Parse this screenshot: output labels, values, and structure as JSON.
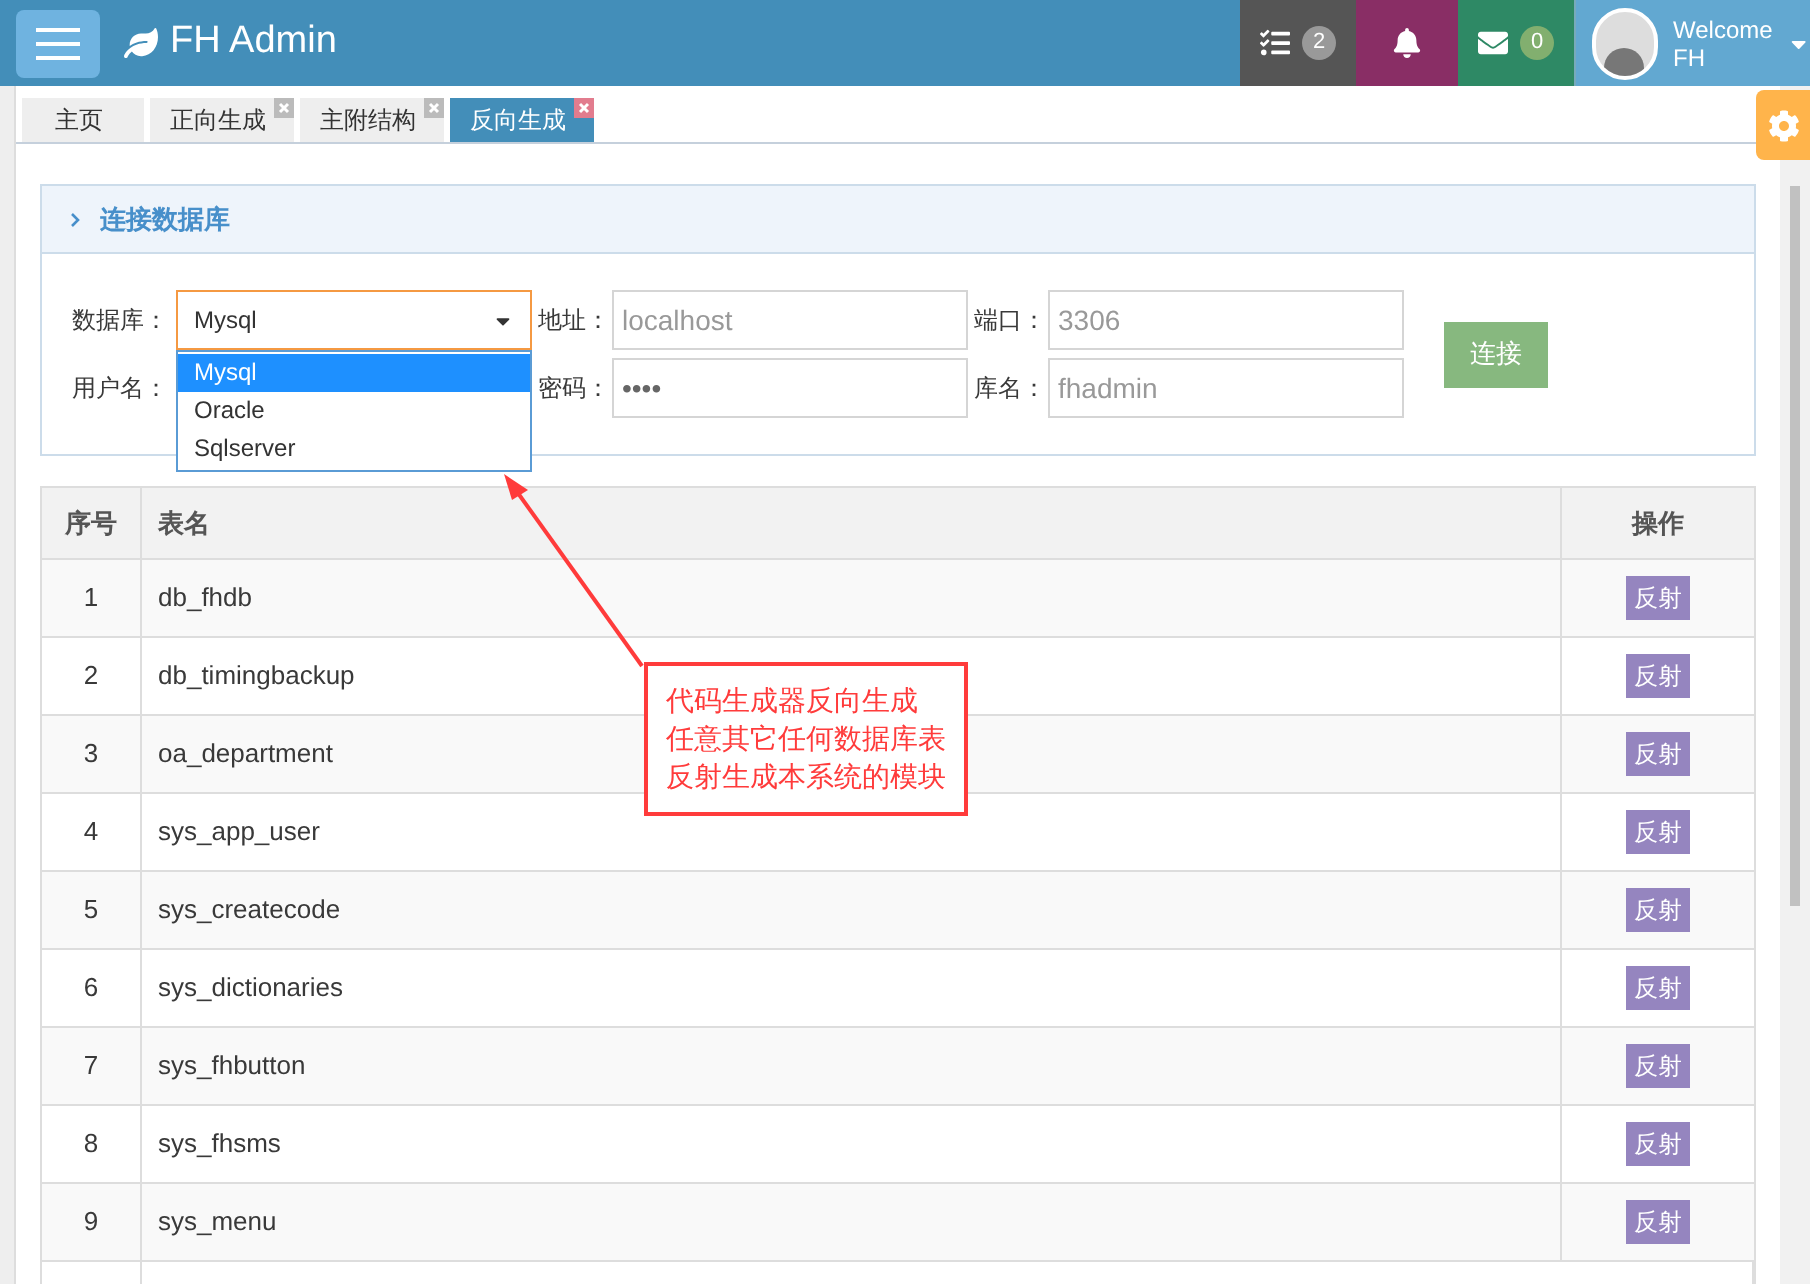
{
  "navbar": {
    "brand": "FH Admin",
    "tasks_count": "2",
    "messages_count": "0",
    "welcome": "Welcome",
    "user": "FH"
  },
  "tabs": [
    {
      "label": "主页",
      "selected": false,
      "closable": false
    },
    {
      "label": "正向生成",
      "selected": false,
      "closable": true
    },
    {
      "label": "主附结构",
      "selected": false,
      "closable": true
    },
    {
      "label": "反向生成",
      "selected": true,
      "closable": true
    }
  ],
  "panel": {
    "title": "连接数据库",
    "fields": {
      "db_label": "数据库：",
      "db_value": "Mysql",
      "address_label": "地址：",
      "address_placeholder": "localhost",
      "port_label": "端口：",
      "port_placeholder": "3306",
      "user_label": "用户名：",
      "password_label": "密码：",
      "password_value": "••••",
      "dbname_label": "库名：",
      "dbname_placeholder": "fhadmin"
    },
    "db_options": [
      {
        "label": "Mysql",
        "selected": true
      },
      {
        "label": "Oracle",
        "selected": false
      },
      {
        "label": "Sqlserver",
        "selected": false
      }
    ],
    "connect_button": "连接"
  },
  "table": {
    "columns": [
      "序号",
      "表名",
      "操作"
    ],
    "rows": [
      {
        "index": "1",
        "name": "db_fhdb",
        "action": "反射"
      },
      {
        "index": "2",
        "name": "db_timingbackup",
        "action": "反射"
      },
      {
        "index": "3",
        "name": "oa_department",
        "action": "反射"
      },
      {
        "index": "4",
        "name": "sys_app_user",
        "action": "反射"
      },
      {
        "index": "5",
        "name": "sys_createcode",
        "action": "反射"
      },
      {
        "index": "6",
        "name": "sys_dictionaries",
        "action": "反射"
      },
      {
        "index": "7",
        "name": "sys_fhbutton",
        "action": "反射"
      },
      {
        "index": "8",
        "name": "sys_fhsms",
        "action": "反射"
      },
      {
        "index": "9",
        "name": "sys_menu",
        "action": "反射"
      }
    ]
  },
  "annotation": [
    "代码生成器反向生成",
    "任意其它任何数据库表",
    "反射生成本系统的模块"
  ]
}
